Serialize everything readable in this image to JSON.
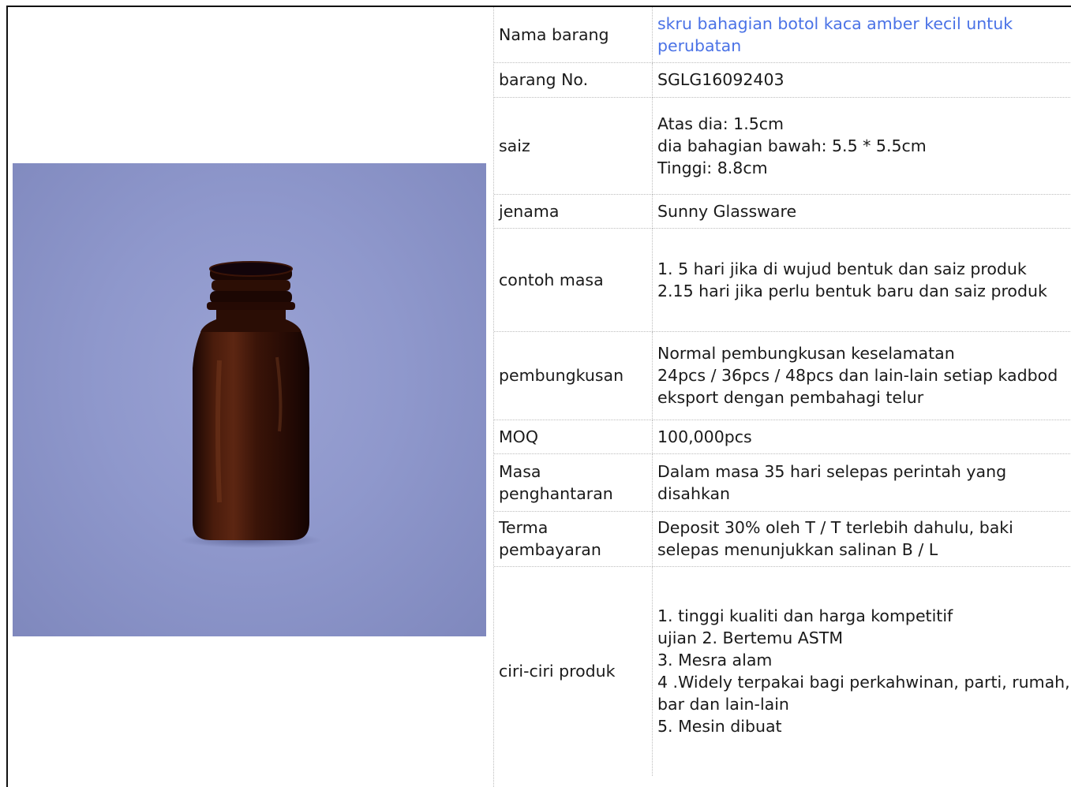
{
  "product": {
    "image_alt": "amber glass bottle"
  },
  "specs": [
    {
      "label": "Nama barang",
      "lines": [
        "skru bahagian botol kaca amber kecil untuk perubatan"
      ],
      "link": true
    },
    {
      "label": "barang No.",
      "lines": [
        "SGLG16092403"
      ]
    },
    {
      "label": "saiz",
      "lines": [
        "Atas dia: 1.5cm",
        "dia bahagian bawah: 5.5 * 5.5cm",
        "Tinggi: 8.8cm"
      ]
    },
    {
      "label": "jenama",
      "lines": [
        "Sunny Glassware"
      ]
    },
    {
      "label": "contoh masa",
      "lines": [
        "1. 5 hari jika di wujud bentuk dan saiz produk",
        "2.15 hari jika perlu bentuk baru dan saiz produk"
      ]
    },
    {
      "label": "pembungkusan",
      "lines": [
        "Normal pembungkusan keselamatan",
        "24pcs / 36pcs / 48pcs dan lain-lain setiap kadbod eksport dengan pembahagi telur"
      ]
    },
    {
      "label": "MOQ",
      "lines": [
        "100,000pcs"
      ]
    },
    {
      "label": "Masa penghantaran",
      "lines": [
        "Dalam masa 35 hari selepas perintah yang disahkan"
      ]
    },
    {
      "label": "Terma pembayaran",
      "lines": [
        "Deposit 30% oleh T / T terlebih dahulu, baki selepas menunjukkan salinan B / L"
      ]
    },
    {
      "label": "ciri-ciri produk",
      "lines": [
        "1. tinggi kualiti dan harga kompetitif",
        "ujian 2. Bertemu ASTM",
        "3. Mesra alam",
        "4 .Widely terpakai bagi perkahwinan, parti, rumah, bar dan lain-lain",
        "5. Mesin dibuat"
      ]
    }
  ],
  "colors": {
    "link": "#4a72e6",
    "photo_bg": "#8f98cc",
    "amber": "#3a1408"
  }
}
